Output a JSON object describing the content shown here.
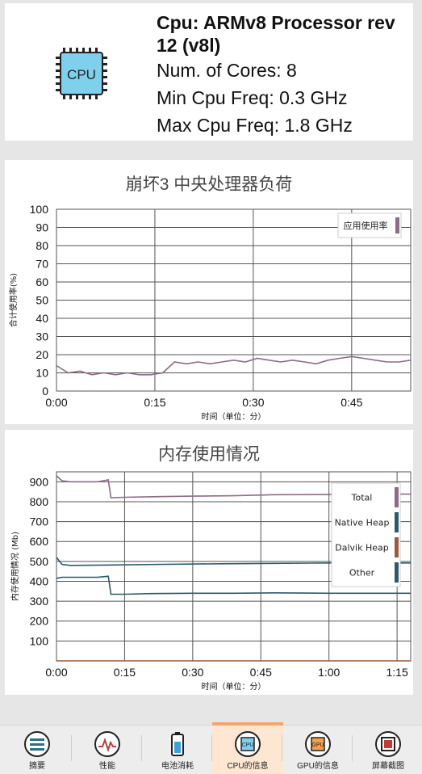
{
  "device_info": {
    "cpu_line": "Cpu:  ARMv8 Processor rev 12 (v8l)",
    "cores_line": "Num. of Cores: 8",
    "min_freq_line": "Min Cpu Freq: 0.3 GHz",
    "max_freq_line": "Max Cpu Freq: 1.8 GHz",
    "chip_label": "CPU",
    "icon": "cpu-chip-icon"
  },
  "chart_data": [
    {
      "type": "line",
      "title": "崩坏3 中央处理器负荷",
      "xlabel": "时间（单位：分）",
      "ylabel": "合计使用率(%)",
      "xlim": [
        0,
        0.9
      ],
      "ylim": [
        0,
        100
      ],
      "x_ticks": [
        "0:00",
        "0:15",
        "0:30",
        "0:45"
      ],
      "y_ticks": [
        "0",
        "10",
        "20",
        "30",
        "40",
        "50",
        "60",
        "70",
        "80",
        "90",
        "100"
      ],
      "grid": true,
      "legend": "top-right",
      "series": [
        {
          "name": "应用使用率",
          "color": "#8c6b87",
          "x": [
            0,
            0.03,
            0.06,
            0.09,
            0.12,
            0.15,
            0.18,
            0.21,
            0.24,
            0.27,
            0.3,
            0.33,
            0.36,
            0.39,
            0.42,
            0.45,
            0.48,
            0.51,
            0.54,
            0.57,
            0.6,
            0.63,
            0.66,
            0.69,
            0.72,
            0.75,
            0.78,
            0.81,
            0.84,
            0.87,
            0.9
          ],
          "values": [
            14,
            10,
            11,
            9,
            10,
            9,
            10,
            9,
            9,
            10,
            16,
            15,
            16,
            15,
            16,
            17,
            16,
            18,
            17,
            16,
            17,
            16,
            15,
            17,
            18,
            19,
            18,
            17,
            16,
            16,
            17
          ]
        }
      ]
    },
    {
      "type": "line",
      "title": "内存使用情况",
      "xlabel": "时间（单位：分）",
      "ylabel": "内存使用情况 (Mb)",
      "xlim": [
        0,
        1.3
      ],
      "ylim": [
        0,
        950
      ],
      "x_ticks": [
        "0:00",
        "0:15",
        "0:30",
        "0:45",
        "1:00",
        "1:15"
      ],
      "y_ticks": [
        "100",
        "200",
        "300",
        "400",
        "500",
        "600",
        "700",
        "800",
        "900"
      ],
      "grid": true,
      "legend": "right",
      "series": [
        {
          "name": "Total",
          "color": "#8c6b87",
          "x": [
            0,
            0.02,
            0.05,
            0.1,
            0.15,
            0.19,
            0.2,
            0.25,
            0.35,
            0.5,
            0.65,
            0.8,
            1.0,
            1.15,
            1.3
          ],
          "values": [
            930,
            905,
            900,
            900,
            900,
            910,
            820,
            822,
            825,
            828,
            830,
            835,
            836,
            838,
            838
          ]
        },
        {
          "name": "Native Heap",
          "color": "#2c5a6b",
          "x": [
            0,
            0.02,
            0.05,
            0.1,
            0.15,
            0.19,
            0.2,
            0.25,
            0.35,
            0.5,
            0.65,
            0.8,
            1.0,
            1.15,
            1.3
          ],
          "values": [
            415,
            420,
            420,
            420,
            420,
            425,
            335,
            335,
            338,
            340,
            340,
            342,
            340,
            340,
            340
          ]
        },
        {
          "name": "Dalvik Heap",
          "color": "#9b5a3c",
          "x": [
            0,
            1.3
          ],
          "values": [
            0,
            0
          ]
        },
        {
          "name": "Other",
          "color": "#2c5a6b",
          "x": [
            0,
            0.02,
            0.05,
            0.2,
            0.4,
            0.6,
            0.8,
            1.0,
            1.3
          ],
          "values": [
            520,
            485,
            480,
            482,
            485,
            488,
            490,
            492,
            492
          ]
        }
      ]
    }
  ],
  "bottom_nav": [
    {
      "label": "摘要",
      "icon": "list-icon"
    },
    {
      "label": "性能",
      "icon": "performance-gauge-icon"
    },
    {
      "label": "电池消耗",
      "icon": "battery-icon"
    },
    {
      "label": "CPU的信息",
      "icon": "cpu-icon",
      "active": true
    },
    {
      "label": "GPU的信息",
      "icon": "gpu-icon"
    },
    {
      "label": "屏幕截图",
      "icon": "film-icon"
    }
  ]
}
